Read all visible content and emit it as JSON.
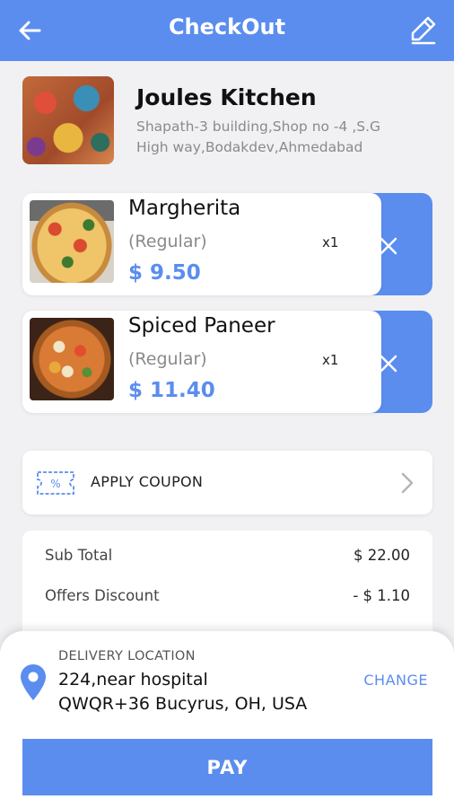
{
  "header": {
    "title": "CheckOut",
    "back_icon": "arrow-left-icon",
    "edit_icon": "pencil-icon"
  },
  "restaurant": {
    "name": "Joules Kitchen",
    "address_line1": "Shapath-3 building,Shop no -4 ,S.G",
    "address_line2": "High way,Bodakdev,Ahmedabad"
  },
  "cart": {
    "items": [
      {
        "name": "Margherita",
        "variant": "(Regular)",
        "qty": "x1",
        "price": "$ 9.50"
      },
      {
        "name": "Spiced Paneer",
        "variant": "(Regular)",
        "qty": "x1",
        "price": "$ 11.40"
      }
    ]
  },
  "coupon": {
    "label": "APPLY COUPON"
  },
  "summary": {
    "rows": [
      {
        "label": "Sub Total",
        "value": "$ 22.00"
      },
      {
        "label": "Offers Discount",
        "value": "- $ 1.10"
      }
    ]
  },
  "delivery": {
    "label": "DELIVERY LOCATION",
    "address_line1": "224,near hospital",
    "address_line2": "QWQR+36 Bucyrus, OH, USA",
    "change_label": "CHANGE"
  },
  "pay": {
    "label": "PAY"
  },
  "colors": {
    "primary": "#5b8def",
    "background": "#f1f1f3"
  }
}
